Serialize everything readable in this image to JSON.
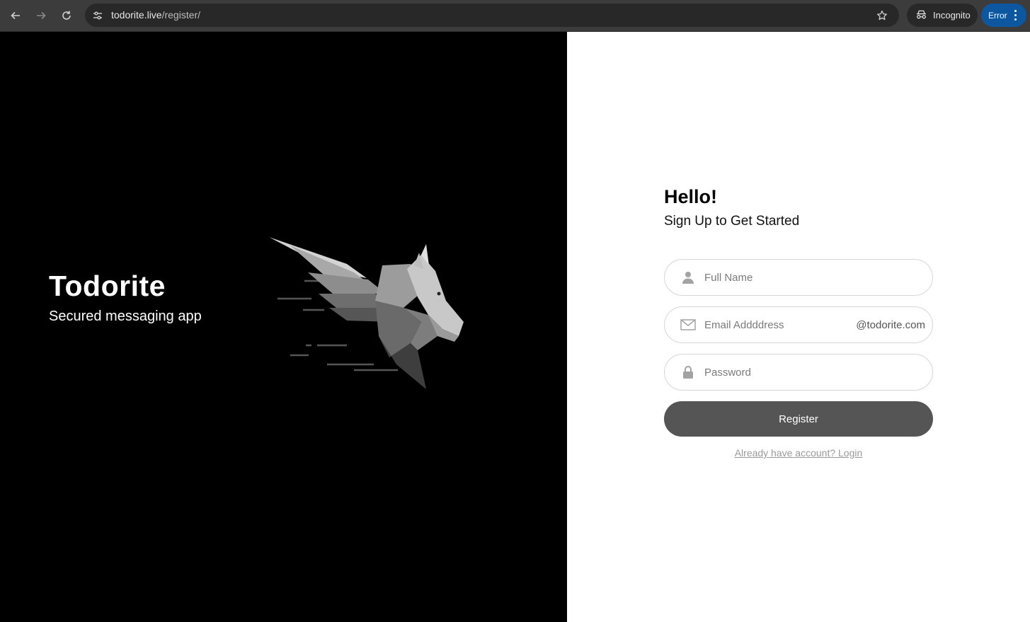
{
  "browser": {
    "url_host": "todorite.live",
    "url_path": "/register/",
    "incognito_label": "Incognito",
    "error_label": "Error"
  },
  "brand": {
    "title": "Todorite",
    "tagline": "Secured messaging app"
  },
  "form": {
    "heading": "Hello!",
    "subheading": "Sign Up to Get Started",
    "full_name_placeholder": "Full Name",
    "email_placeholder": "Email Addddress",
    "email_suffix": "@todorite.com",
    "password_placeholder": "Password",
    "register_label": "Register",
    "login_link": "Already have account? Login"
  },
  "icons": {
    "back": "back-arrow-icon",
    "forward": "forward-arrow-icon",
    "reload": "reload-icon",
    "site_info": "tune-icon",
    "bookmark": "star-icon",
    "incognito": "incognito-icon",
    "menu": "kebab-menu-icon",
    "name": "user-icon",
    "email": "envelope-icon",
    "password": "lock-icon",
    "logo": "pegasus-icon"
  },
  "colors": {
    "left_bg": "#000000",
    "right_bg": "#ffffff",
    "button_bg": "#555555",
    "error_pill": "#0d57a0"
  }
}
